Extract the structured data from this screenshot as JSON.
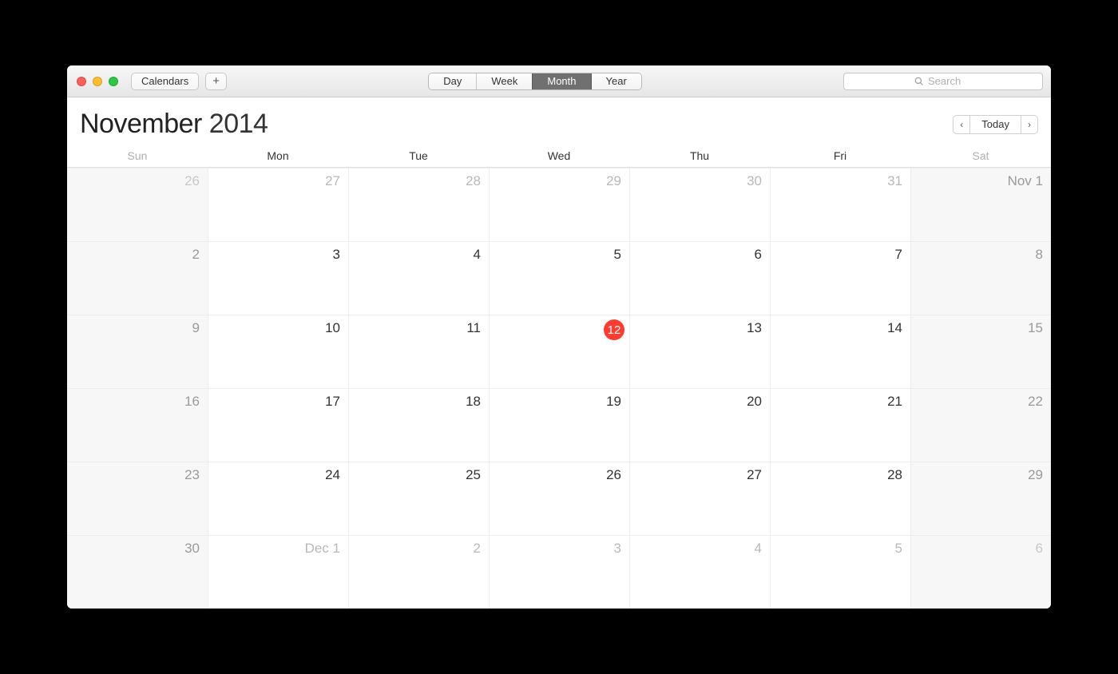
{
  "toolbar": {
    "calendars_label": "Calendars",
    "add_label": "+",
    "views": {
      "day": "Day",
      "week": "Week",
      "month": "Month",
      "year": "Year",
      "active": "month"
    },
    "search_placeholder": "Search"
  },
  "header": {
    "month": "November",
    "year": "2014",
    "today_label": "Today",
    "prev_symbol": "‹",
    "next_symbol": "›"
  },
  "dow": [
    "Sun",
    "Mon",
    "Tue",
    "Wed",
    "Thu",
    "Fri",
    "Sat"
  ],
  "today_day": 12,
  "grid": [
    [
      {
        "label": "26",
        "other": true,
        "weekend": true
      },
      {
        "label": "27",
        "other": true
      },
      {
        "label": "28",
        "other": true
      },
      {
        "label": "29",
        "other": true
      },
      {
        "label": "30",
        "other": true
      },
      {
        "label": "31",
        "other": true
      },
      {
        "label": "Nov 1",
        "weekend": true
      }
    ],
    [
      {
        "label": "2",
        "weekend": true
      },
      {
        "label": "3"
      },
      {
        "label": "4"
      },
      {
        "label": "5"
      },
      {
        "label": "6"
      },
      {
        "label": "7"
      },
      {
        "label": "8",
        "weekend": true
      }
    ],
    [
      {
        "label": "9",
        "weekend": true
      },
      {
        "label": "10"
      },
      {
        "label": "11"
      },
      {
        "label": "12",
        "today": true
      },
      {
        "label": "13"
      },
      {
        "label": "14"
      },
      {
        "label": "15",
        "weekend": true
      }
    ],
    [
      {
        "label": "16",
        "weekend": true
      },
      {
        "label": "17"
      },
      {
        "label": "18"
      },
      {
        "label": "19"
      },
      {
        "label": "20"
      },
      {
        "label": "21"
      },
      {
        "label": "22",
        "weekend": true
      }
    ],
    [
      {
        "label": "23",
        "weekend": true
      },
      {
        "label": "24"
      },
      {
        "label": "25"
      },
      {
        "label": "26"
      },
      {
        "label": "27"
      },
      {
        "label": "28"
      },
      {
        "label": "29",
        "weekend": true
      }
    ],
    [
      {
        "label": "30",
        "weekend": true
      },
      {
        "label": "Dec 1",
        "other": true
      },
      {
        "label": "2",
        "other": true
      },
      {
        "label": "3",
        "other": true
      },
      {
        "label": "4",
        "other": true
      },
      {
        "label": "5",
        "other": true
      },
      {
        "label": "6",
        "other": true,
        "weekend": true
      }
    ]
  ]
}
